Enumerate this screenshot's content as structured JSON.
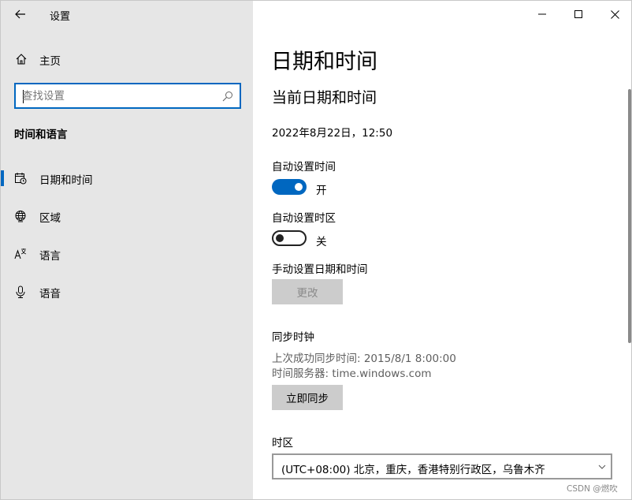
{
  "app": {
    "title": "设置"
  },
  "sidebar": {
    "home_label": "主页",
    "search_placeholder": "查找设置",
    "section_title": "时间和语言",
    "items": [
      {
        "label": "日期和时间",
        "icon": "calendar-clock-icon",
        "selected": true
      },
      {
        "label": "区域",
        "icon": "globe-icon",
        "selected": false
      },
      {
        "label": "语言",
        "icon": "language-icon",
        "selected": false
      },
      {
        "label": "语音",
        "icon": "microphone-icon",
        "selected": false
      }
    ]
  },
  "main": {
    "page_title": "日期和时间",
    "subhead": "当前日期和时间",
    "current_datetime": "2022年8月22日，12:50",
    "auto_time": {
      "label": "自动设置时间",
      "state": "开",
      "on": true
    },
    "auto_timezone": {
      "label": "自动设置时区",
      "state": "关",
      "on": false
    },
    "manual": {
      "label": "手动设置日期和时间",
      "button": "更改"
    },
    "sync": {
      "label": "同步时钟",
      "last_sync": "上次成功同步时间: 2015/8/1 8:00:00",
      "server": "时间服务器: time.windows.com",
      "button": "立即同步"
    },
    "timezone": {
      "label": "时区",
      "value": "(UTC+08:00) 北京，重庆，香港特别行政区，乌鲁木齐"
    }
  },
  "watermark": "CSDN @燃吹",
  "colors": {
    "accent": "#0067c0",
    "sidebar_bg": "#e6e6e6",
    "button_bg": "#cccccc"
  }
}
